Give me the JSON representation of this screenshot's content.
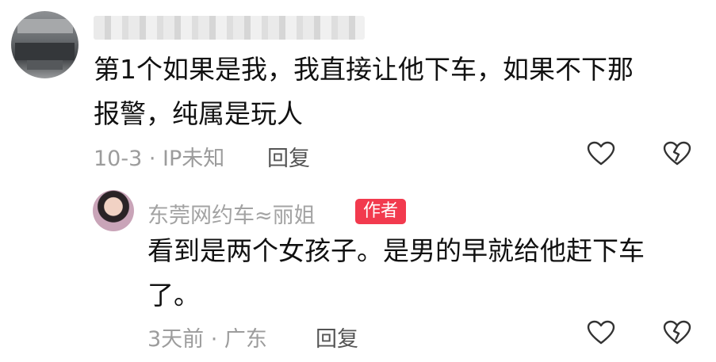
{
  "comments": [
    {
      "text": "第1个如果是我，我直接让他下车，如果不下那报警，纯属是玩人",
      "line1": "第1个如果是我，我直接让他下车，如果不下那",
      "line2": "报警，纯属是玩人",
      "meta": "10-3 · IP未知",
      "reply_label": "回复",
      "icons": {
        "like": "heart-icon",
        "dislike": "broken-heart-icon"
      }
    }
  ],
  "reply": {
    "username": "东莞网约车≈丽姐",
    "badge": "作者",
    "line1": "看到是两个女孩子。是男的早就给他赶下车",
    "line2": "了。",
    "meta": "3天前 · 广东",
    "reply_label": "回复",
    "badge_color": "#f23a4e",
    "icons": {
      "like": "heart-icon",
      "dislike": "broken-heart-icon"
    }
  }
}
